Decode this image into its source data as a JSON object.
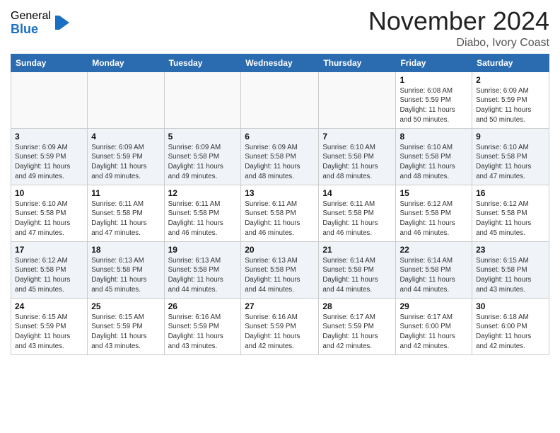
{
  "header": {
    "logo_general": "General",
    "logo_blue": "Blue",
    "month_title": "November 2024",
    "location": "Diabo, Ivory Coast"
  },
  "days_of_week": [
    "Sunday",
    "Monday",
    "Tuesday",
    "Wednesday",
    "Thursday",
    "Friday",
    "Saturday"
  ],
  "weeks": [
    [
      {
        "day": "",
        "info": ""
      },
      {
        "day": "",
        "info": ""
      },
      {
        "day": "",
        "info": ""
      },
      {
        "day": "",
        "info": ""
      },
      {
        "day": "",
        "info": ""
      },
      {
        "day": "1",
        "info": "Sunrise: 6:08 AM\nSunset: 5:59 PM\nDaylight: 11 hours\nand 50 minutes."
      },
      {
        "day": "2",
        "info": "Sunrise: 6:09 AM\nSunset: 5:59 PM\nDaylight: 11 hours\nand 50 minutes."
      }
    ],
    [
      {
        "day": "3",
        "info": "Sunrise: 6:09 AM\nSunset: 5:59 PM\nDaylight: 11 hours\nand 49 minutes."
      },
      {
        "day": "4",
        "info": "Sunrise: 6:09 AM\nSunset: 5:59 PM\nDaylight: 11 hours\nand 49 minutes."
      },
      {
        "day": "5",
        "info": "Sunrise: 6:09 AM\nSunset: 5:58 PM\nDaylight: 11 hours\nand 49 minutes."
      },
      {
        "day": "6",
        "info": "Sunrise: 6:09 AM\nSunset: 5:58 PM\nDaylight: 11 hours\nand 48 minutes."
      },
      {
        "day": "7",
        "info": "Sunrise: 6:10 AM\nSunset: 5:58 PM\nDaylight: 11 hours\nand 48 minutes."
      },
      {
        "day": "8",
        "info": "Sunrise: 6:10 AM\nSunset: 5:58 PM\nDaylight: 11 hours\nand 48 minutes."
      },
      {
        "day": "9",
        "info": "Sunrise: 6:10 AM\nSunset: 5:58 PM\nDaylight: 11 hours\nand 47 minutes."
      }
    ],
    [
      {
        "day": "10",
        "info": "Sunrise: 6:10 AM\nSunset: 5:58 PM\nDaylight: 11 hours\nand 47 minutes."
      },
      {
        "day": "11",
        "info": "Sunrise: 6:11 AM\nSunset: 5:58 PM\nDaylight: 11 hours\nand 47 minutes."
      },
      {
        "day": "12",
        "info": "Sunrise: 6:11 AM\nSunset: 5:58 PM\nDaylight: 11 hours\nand 46 minutes."
      },
      {
        "day": "13",
        "info": "Sunrise: 6:11 AM\nSunset: 5:58 PM\nDaylight: 11 hours\nand 46 minutes."
      },
      {
        "day": "14",
        "info": "Sunrise: 6:11 AM\nSunset: 5:58 PM\nDaylight: 11 hours\nand 46 minutes."
      },
      {
        "day": "15",
        "info": "Sunrise: 6:12 AM\nSunset: 5:58 PM\nDaylight: 11 hours\nand 46 minutes."
      },
      {
        "day": "16",
        "info": "Sunrise: 6:12 AM\nSunset: 5:58 PM\nDaylight: 11 hours\nand 45 minutes."
      }
    ],
    [
      {
        "day": "17",
        "info": "Sunrise: 6:12 AM\nSunset: 5:58 PM\nDaylight: 11 hours\nand 45 minutes."
      },
      {
        "day": "18",
        "info": "Sunrise: 6:13 AM\nSunset: 5:58 PM\nDaylight: 11 hours\nand 45 minutes."
      },
      {
        "day": "19",
        "info": "Sunrise: 6:13 AM\nSunset: 5:58 PM\nDaylight: 11 hours\nand 44 minutes."
      },
      {
        "day": "20",
        "info": "Sunrise: 6:13 AM\nSunset: 5:58 PM\nDaylight: 11 hours\nand 44 minutes."
      },
      {
        "day": "21",
        "info": "Sunrise: 6:14 AM\nSunset: 5:58 PM\nDaylight: 11 hours\nand 44 minutes."
      },
      {
        "day": "22",
        "info": "Sunrise: 6:14 AM\nSunset: 5:58 PM\nDaylight: 11 hours\nand 44 minutes."
      },
      {
        "day": "23",
        "info": "Sunrise: 6:15 AM\nSunset: 5:58 PM\nDaylight: 11 hours\nand 43 minutes."
      }
    ],
    [
      {
        "day": "24",
        "info": "Sunrise: 6:15 AM\nSunset: 5:59 PM\nDaylight: 11 hours\nand 43 minutes."
      },
      {
        "day": "25",
        "info": "Sunrise: 6:15 AM\nSunset: 5:59 PM\nDaylight: 11 hours\nand 43 minutes."
      },
      {
        "day": "26",
        "info": "Sunrise: 6:16 AM\nSunset: 5:59 PM\nDaylight: 11 hours\nand 43 minutes."
      },
      {
        "day": "27",
        "info": "Sunrise: 6:16 AM\nSunset: 5:59 PM\nDaylight: 11 hours\nand 42 minutes."
      },
      {
        "day": "28",
        "info": "Sunrise: 6:17 AM\nSunset: 5:59 PM\nDaylight: 11 hours\nand 42 minutes."
      },
      {
        "day": "29",
        "info": "Sunrise: 6:17 AM\nSunset: 6:00 PM\nDaylight: 11 hours\nand 42 minutes."
      },
      {
        "day": "30",
        "info": "Sunrise: 6:18 AM\nSunset: 6:00 PM\nDaylight: 11 hours\nand 42 minutes."
      }
    ]
  ]
}
